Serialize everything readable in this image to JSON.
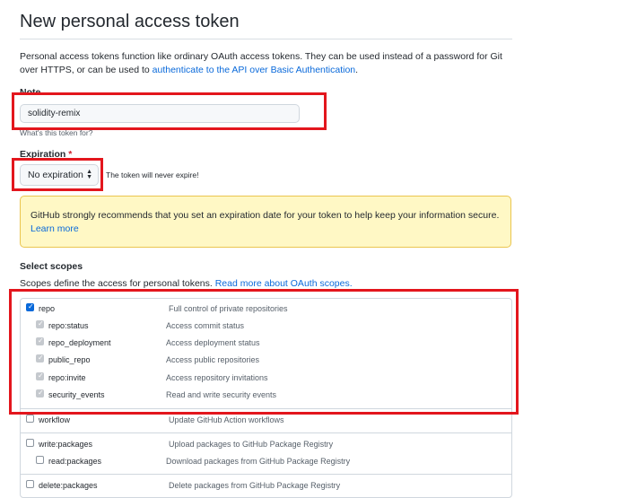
{
  "page": {
    "title": "New personal access token",
    "intro_text": "Personal access tokens function like ordinary OAuth access tokens. They can be used instead of a password for Git over HTTPS, or can be used to ",
    "intro_link": "authenticate to the API over Basic Authentication",
    "intro_end": "."
  },
  "note": {
    "label": "Note",
    "value": "solidity-remix",
    "hint": "What's this token for?"
  },
  "expiration": {
    "label": "Expiration",
    "required_mark": "*",
    "selected": "No expiration",
    "hint": "The token will never expire!"
  },
  "warning": {
    "text": "GitHub strongly recommends that you set an expiration date for your token to help keep your information secure.",
    "link": "Learn more"
  },
  "scopes": {
    "heading": "Select scopes",
    "desc": "Scopes define the access for personal tokens. ",
    "desc_link": "Read more about OAuth scopes.",
    "items": [
      {
        "name": "repo",
        "desc": "Full control of private repositories"
      },
      {
        "name": "repo:status",
        "desc": "Access commit status"
      },
      {
        "name": "repo_deployment",
        "desc": "Access deployment status"
      },
      {
        "name": "public_repo",
        "desc": "Access public repositories"
      },
      {
        "name": "repo:invite",
        "desc": "Access repository invitations"
      },
      {
        "name": "security_events",
        "desc": "Read and write security events"
      },
      {
        "name": "workflow",
        "desc": "Update GitHub Action workflows"
      },
      {
        "name": "write:packages",
        "desc": "Upload packages to GitHub Package Registry"
      },
      {
        "name": "read:packages",
        "desc": "Download packages from GitHub Package Registry"
      },
      {
        "name": "delete:packages",
        "desc": "Delete packages from GitHub Package Registry"
      }
    ]
  },
  "colors": {
    "highlight": "#e3161d",
    "link": "#0969da",
    "warning_bg": "#fff8c5"
  }
}
